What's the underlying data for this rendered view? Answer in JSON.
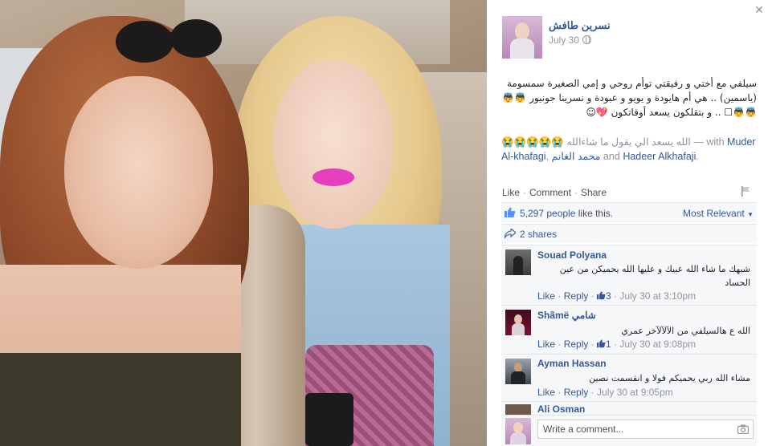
{
  "post": {
    "author": "نسرين طافش",
    "date": "July 30",
    "text": "سيلفي مع أختي و رفيقتي توأم روحي و إمي الصغيرة سمسومة (ياسمين) .. هي أم هايودة و يويو و عبودة و نسرينا جونيور 👼👼👼👼☐ .. و بتقلكون يسعد أوقاتكون 💖☺",
    "with_text_ar": "الله يسعد الي يقول ما شاءالله",
    "with_emojis": "😭😭😭😭😭",
    "with_sep": "— with",
    "tag1": "Muder Al-khafagi",
    "tag2": "محمد الغانم",
    "tag3": "Hadeer Alkhafaji",
    "and_word": "and"
  },
  "actions": {
    "like": "Like",
    "comment": "Comment",
    "share": "Share"
  },
  "likes": {
    "count": "5,297 people",
    "suffix": "like this.",
    "sort": "Most Relevant"
  },
  "shares": "2 shares",
  "comments": [
    {
      "name": "Souad Polyana",
      "text": "شبهك ما شاء الله عبيك و عليها الله يحميكن من عين الحساد",
      "like": "Like",
      "reply": "Reply",
      "likes": "3",
      "time": "July 30 at 3:10pm"
    },
    {
      "name": "Shãmë شامي",
      "text": "الله ع هالسيلفي من الآلآلآخر عمري",
      "like": "Like",
      "reply": "Reply",
      "likes": "1",
      "time": "July 30 at 9:08pm"
    },
    {
      "name": "Ayman Hassan",
      "text": "مشاء الله ربي يحميكم فولا و انقسمت نصين",
      "like": "Like",
      "reply": "Reply",
      "likes": "",
      "time": "July 30 at 9:05pm"
    },
    {
      "name": "Ali Osman"
    }
  ],
  "write_comment": {
    "placeholder": "Write a comment..."
  },
  "icons": {
    "close": "close-icon",
    "globe": "globe-icon",
    "flag": "flag-icon",
    "thumb": "thumbs-up-icon",
    "share": "share-icon",
    "camera": "camera-icon"
  },
  "colors": {
    "link": "#365899",
    "meta": "#90949c",
    "panel_bg": "#ffffff",
    "comment_bg": "#f6f7f9",
    "lip_accent": "#e63fbd"
  }
}
